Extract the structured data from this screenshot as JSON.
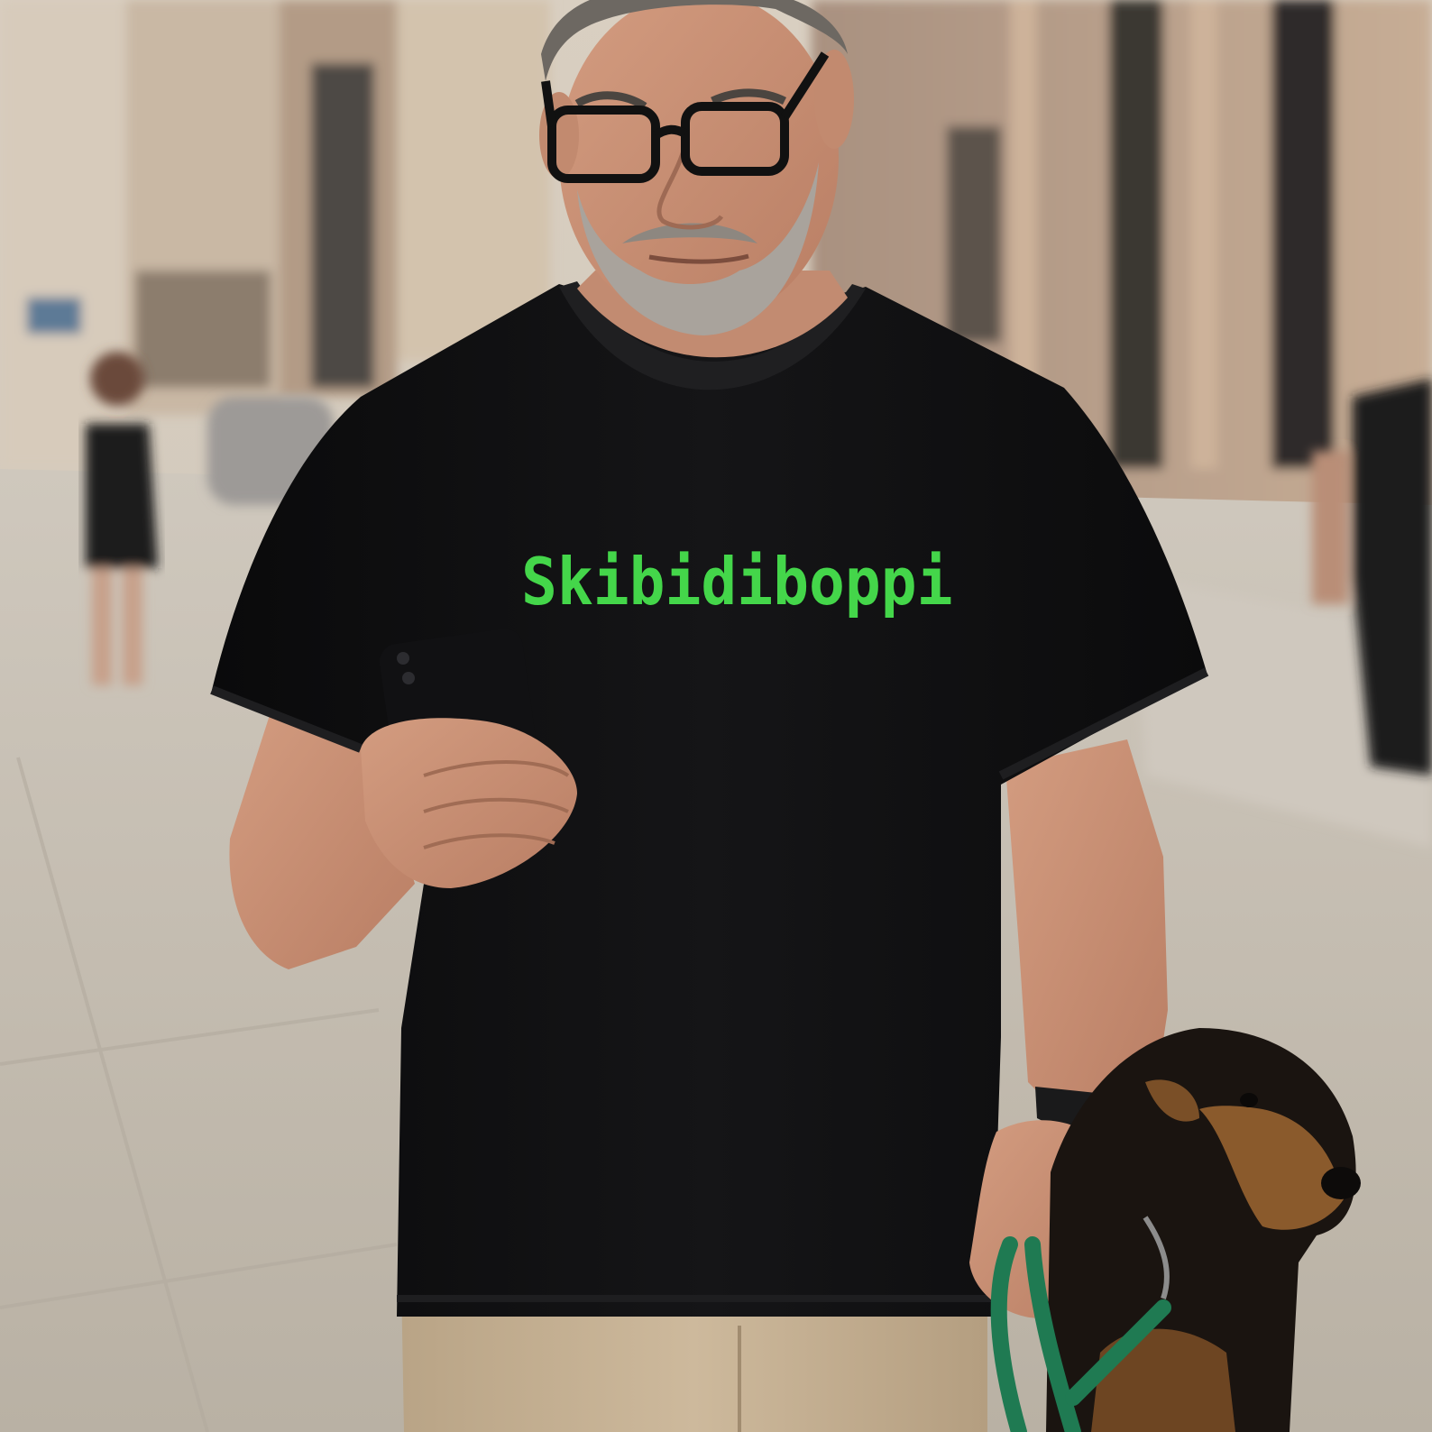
{
  "photo": {
    "shirt_text": "Skibidiboppi",
    "colors": {
      "shirt_print": "#44d64a",
      "shirt": "#0d0d0e",
      "skin": "#c98f74",
      "pants": "#c8b396",
      "leash": "#1f7a52",
      "dog_dark": "#1a1410",
      "dog_tan": "#8a5a2c",
      "street": "#c8c1b5",
      "building": "#bfa58e"
    }
  }
}
